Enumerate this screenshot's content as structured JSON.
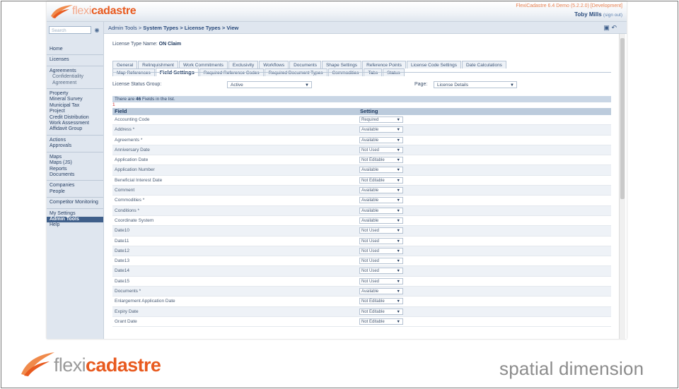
{
  "app": {
    "logo": {
      "part1": "flexi",
      "part2": "cadastre"
    },
    "version": "FlexiCadastre 6.4 Demo (5.2.2.0) [Development]",
    "user": {
      "name": "Toby Mills",
      "signout": "(sign out)"
    }
  },
  "sidebar": {
    "search_placeholder": "Search",
    "search_icon": "binoculars-icon",
    "items": [
      {
        "label": "Home"
      },
      {
        "label": "Licenses"
      },
      {
        "label": "Agreements"
      },
      {
        "label": "Confidentiality Agreement"
      },
      {
        "label": "Property"
      },
      {
        "label": "Mineral Survey"
      },
      {
        "label": "Municipal Tax"
      },
      {
        "label": "Project"
      },
      {
        "label": "Credit Distribution"
      },
      {
        "label": "Work Assessment"
      },
      {
        "label": "Affidavit Group"
      },
      {
        "label": "Actions"
      },
      {
        "label": "Approvals"
      },
      {
        "label": "Maps"
      },
      {
        "label": "Maps (JS)"
      },
      {
        "label": "Reports"
      },
      {
        "label": "Documents"
      },
      {
        "label": "Companies"
      },
      {
        "label": "People"
      },
      {
        "label": "Competitor Monitoring"
      },
      {
        "label": "My Settings"
      },
      {
        "label": "Admin Tools"
      },
      {
        "label": "Help"
      }
    ]
  },
  "breadcrumb": {
    "prefix": "Admin Tools > ",
    "path": "System Types > License Types > View"
  },
  "header_icons": {
    "save_icon": "save-icon",
    "undo_icon": "undo-icon"
  },
  "license": {
    "label": "License Type Name:",
    "value": "ON Claim"
  },
  "tabs_row1": [
    "General",
    "Relinquishment",
    "Work Commitments",
    "Exclusivity",
    "Workflows",
    "Documents",
    "Shape Settings",
    "Reference Points",
    "License Code Settings",
    "Date Calculations"
  ],
  "tabs_row2": [
    "Map References",
    "Field Settings",
    "Required Reference Codes",
    "Required Document Types",
    "Commodities",
    "Tabs",
    "Status"
  ],
  "active_tab": "Field Settings",
  "filters": {
    "status_group_label": "License Status Group:",
    "status_group_value": "Active",
    "page_label": "Page:",
    "page_value": "License Details"
  },
  "count": {
    "pre": "There are ",
    "num": "46",
    "post": " Fields in the list.",
    "mark": "1"
  },
  "grid": {
    "col_field": "Field",
    "col_setting": "Setting",
    "rows": [
      {
        "field": "Accounting Code",
        "setting": "Required"
      },
      {
        "field": "Address *",
        "setting": "Available"
      },
      {
        "field": "Agreements *",
        "setting": "Available"
      },
      {
        "field": "Anniversary Date",
        "setting": "Not Used"
      },
      {
        "field": "Application Date",
        "setting": "Not Editable"
      },
      {
        "field": "Application Number",
        "setting": "Available"
      },
      {
        "field": "Beneficial Interest Date",
        "setting": "Not Editable"
      },
      {
        "field": "Comment",
        "setting": "Available"
      },
      {
        "field": "Commodities *",
        "setting": "Available"
      },
      {
        "field": "Conditions *",
        "setting": "Available"
      },
      {
        "field": "Coordinate System",
        "setting": "Available"
      },
      {
        "field": "Date10",
        "setting": "Not Used"
      },
      {
        "field": "Date11",
        "setting": "Not Used"
      },
      {
        "field": "Date12",
        "setting": "Not Used"
      },
      {
        "field": "Date13",
        "setting": "Not Used"
      },
      {
        "field": "Date14",
        "setting": "Not Used"
      },
      {
        "field": "Date15",
        "setting": "Not Used"
      },
      {
        "field": "Documents *",
        "setting": "Available"
      },
      {
        "field": "Enlargement Application Date",
        "setting": "Not Editable"
      },
      {
        "field": "Expiry Date",
        "setting": "Not Editable"
      },
      {
        "field": "Grant Date",
        "setting": "Not Editable"
      }
    ]
  },
  "footer": {
    "logo": {
      "part1": "flexi",
      "part2": "cadastre"
    },
    "tagline": "spatial dimension"
  },
  "colors": {
    "brand_orange": "#e85a1f",
    "nav_active": "#3f5f8a",
    "header_blue": "#1f3a60"
  }
}
